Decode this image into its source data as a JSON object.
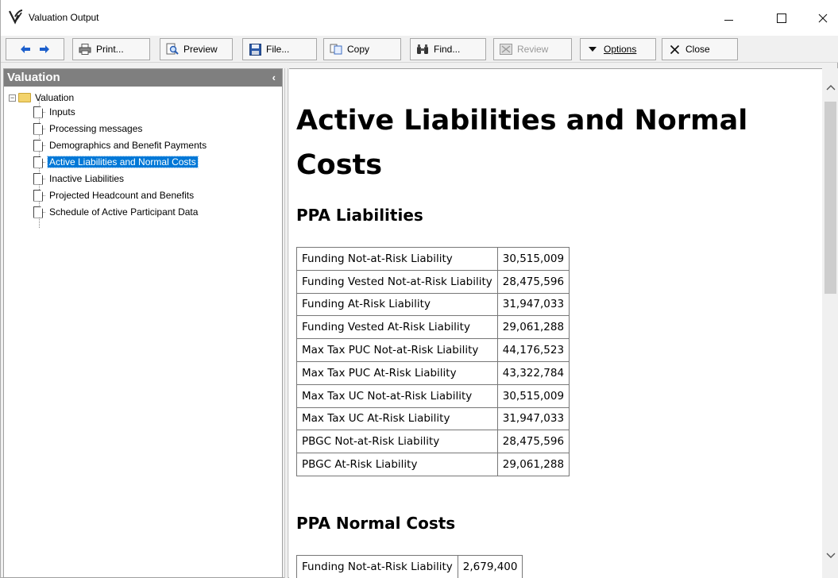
{
  "window": {
    "title": "Valuation Output",
    "icon": "valuation-logo-icon"
  },
  "toolbar": {
    "back_icon": "arrow-left-icon",
    "forward_icon": "arrow-right-icon",
    "print": "Print...",
    "preview": "Preview",
    "file": "File...",
    "copy": "Copy",
    "find": "Find...",
    "review": "Review",
    "options": "Options",
    "close": "Close"
  },
  "sidebar": {
    "header": "Valuation",
    "collapse_glyph": "‹",
    "root": "Valuation",
    "items": [
      {
        "label": "Inputs"
      },
      {
        "label": "Processing messages"
      },
      {
        "label": "Demographics and Benefit Payments"
      },
      {
        "label": "Active Liabilities and Normal Costs"
      },
      {
        "label": "Inactive Liabilities"
      },
      {
        "label": "Projected Headcount and Benefits"
      },
      {
        "label": "Schedule of Active Participant Data"
      }
    ],
    "selected_index": 3
  },
  "main": {
    "title": "Active Liabilities and Normal Costs",
    "ppa_liabilities": {
      "heading": "PPA Liabilities",
      "rows": [
        {
          "label": "Funding Not-at-Risk Liability",
          "value": "30,515,009"
        },
        {
          "label": "Funding Vested Not-at-Risk Liability",
          "value": "28,475,596"
        },
        {
          "label": "Funding At-Risk Liability",
          "value": "31,947,033"
        },
        {
          "label": "Funding Vested At-Risk Liability",
          "value": "29,061,288"
        },
        {
          "label": "Max Tax PUC Not-at-Risk Liability",
          "value": "44,176,523"
        },
        {
          "label": "Max Tax PUC At-Risk Liability",
          "value": "43,322,784"
        },
        {
          "label": "Max Tax UC Not-at-Risk Liability",
          "value": "30,515,009"
        },
        {
          "label": "Max Tax UC At-Risk Liability",
          "value": "31,947,033"
        },
        {
          "label": "PBGC Not-at-Risk Liability",
          "value": "28,475,596"
        },
        {
          "label": "PBGC At-Risk Liability",
          "value": "29,061,288"
        }
      ]
    },
    "ppa_normal_costs": {
      "heading": "PPA Normal Costs",
      "rows": [
        {
          "label": "Funding Not-at-Risk Liability",
          "value": "2,679,400"
        }
      ]
    }
  },
  "colors": {
    "selection": "#0078d7",
    "pane_header": "#7f7f7f"
  }
}
